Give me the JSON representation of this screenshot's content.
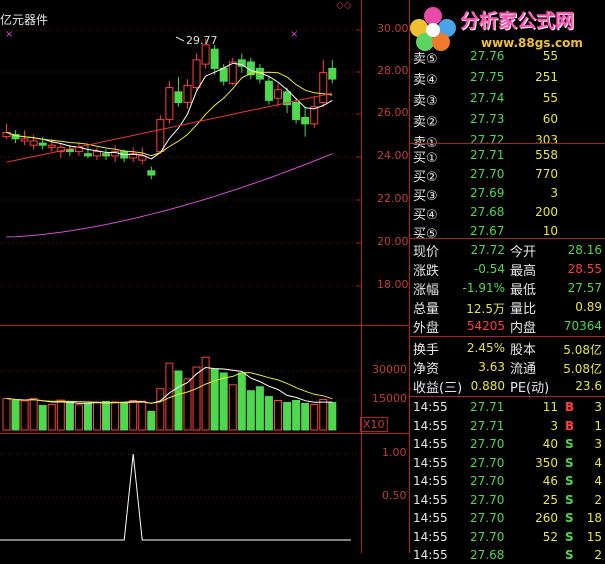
{
  "header": {
    "title": "亿元器件",
    "logo_text": "分析家公式网",
    "logo_url": "www.88gs.com",
    "x10": "X10"
  },
  "price_axis": [
    "30.00",
    "28.00",
    "26.00",
    "24.00",
    "22.00",
    "20.00",
    "18.00"
  ],
  "volume_axis": [
    "30000",
    "15000"
  ],
  "indicator_axis": [
    "1.00",
    "0.50"
  ],
  "max_label": "29.77",
  "sell": [
    {
      "label": "卖⑤",
      "price": "27.76",
      "vol": "55"
    },
    {
      "label": "卖④",
      "price": "27.75",
      "vol": "251"
    },
    {
      "label": "卖③",
      "price": "27.74",
      "vol": "55"
    },
    {
      "label": "卖②",
      "price": "27.73",
      "vol": "60"
    },
    {
      "label": "卖①",
      "price": "27.72",
      "vol": "303"
    }
  ],
  "buy": [
    {
      "label": "买①",
      "price": "27.71",
      "vol": "558"
    },
    {
      "label": "买②",
      "price": "27.70",
      "vol": "770"
    },
    {
      "label": "买③",
      "price": "27.69",
      "vol": "3"
    },
    {
      "label": "买④",
      "price": "27.68",
      "vol": "200"
    },
    {
      "label": "买⑤",
      "price": "27.67",
      "vol": "10"
    }
  ],
  "quote": [
    {
      "l1": "现价",
      "v1": "27.72",
      "c1": "down",
      "l2": "今开",
      "v2": "28.16",
      "c2": "down"
    },
    {
      "l1": "涨跌",
      "v1": "-0.54",
      "c1": "down",
      "l2": "最高",
      "v2": "28.55",
      "c2": "up"
    },
    {
      "l1": "涨幅",
      "v1": "-1.91%",
      "c1": "down",
      "l2": "最低",
      "v2": "27.57",
      "c2": "down"
    },
    {
      "l1": "总量",
      "v1": "12.5万",
      "c1": "vol",
      "l2": "量比",
      "v2": "0.89",
      "c2": "vol"
    },
    {
      "l1": "外盘",
      "v1": "54205",
      "c1": "up",
      "l2": "内盘",
      "v2": "70364",
      "c2": "down"
    }
  ],
  "fund": [
    {
      "l1": "换手",
      "v1": "2.45%",
      "l2": "股本",
      "v2": "5.08亿"
    },
    {
      "l1": "净资",
      "v1": "3.63",
      "l2": "流通",
      "v2": "5.08亿"
    },
    {
      "l1": "收益(三)",
      "v1": "0.880",
      "l2": "PE(动)",
      "v2": "23.6"
    }
  ],
  "ticks": [
    {
      "time": "14:55",
      "price": "27.71",
      "vol": "11",
      "bs": "B",
      "n": "3",
      "c": "up"
    },
    {
      "time": "14:55",
      "price": "27.71",
      "vol": "3",
      "bs": "B",
      "n": "1",
      "c": "up"
    },
    {
      "time": "14:55",
      "price": "27.70",
      "vol": "40",
      "bs": "S",
      "n": "3",
      "c": "down"
    },
    {
      "time": "14:55",
      "price": "27.70",
      "vol": "350",
      "bs": "S",
      "n": "4",
      "c": "down"
    },
    {
      "time": "14:55",
      "price": "27.70",
      "vol": "46",
      "bs": "S",
      "n": "4",
      "c": "down"
    },
    {
      "time": "14:55",
      "price": "27.70",
      "vol": "25",
      "bs": "S",
      "n": "2",
      "c": "down"
    },
    {
      "time": "14:55",
      "price": "27.70",
      "vol": "260",
      "bs": "S",
      "n": "18",
      "c": "down"
    },
    {
      "time": "14:55",
      "price": "27.70",
      "vol": "52",
      "bs": "S",
      "n": "15",
      "c": "down"
    },
    {
      "time": "14:55",
      "price": "27.68",
      "vol": "",
      "bs": "S",
      "n": "2",
      "c": "down"
    }
  ],
  "colors": {
    "up": "#ff3e3e",
    "down": "#4dd84d",
    "grid": "#a22",
    "ma5": "#ffffff",
    "ma10": "#e7e73a",
    "ma20": "#e33",
    "ma60": "#d64ad6"
  }
}
